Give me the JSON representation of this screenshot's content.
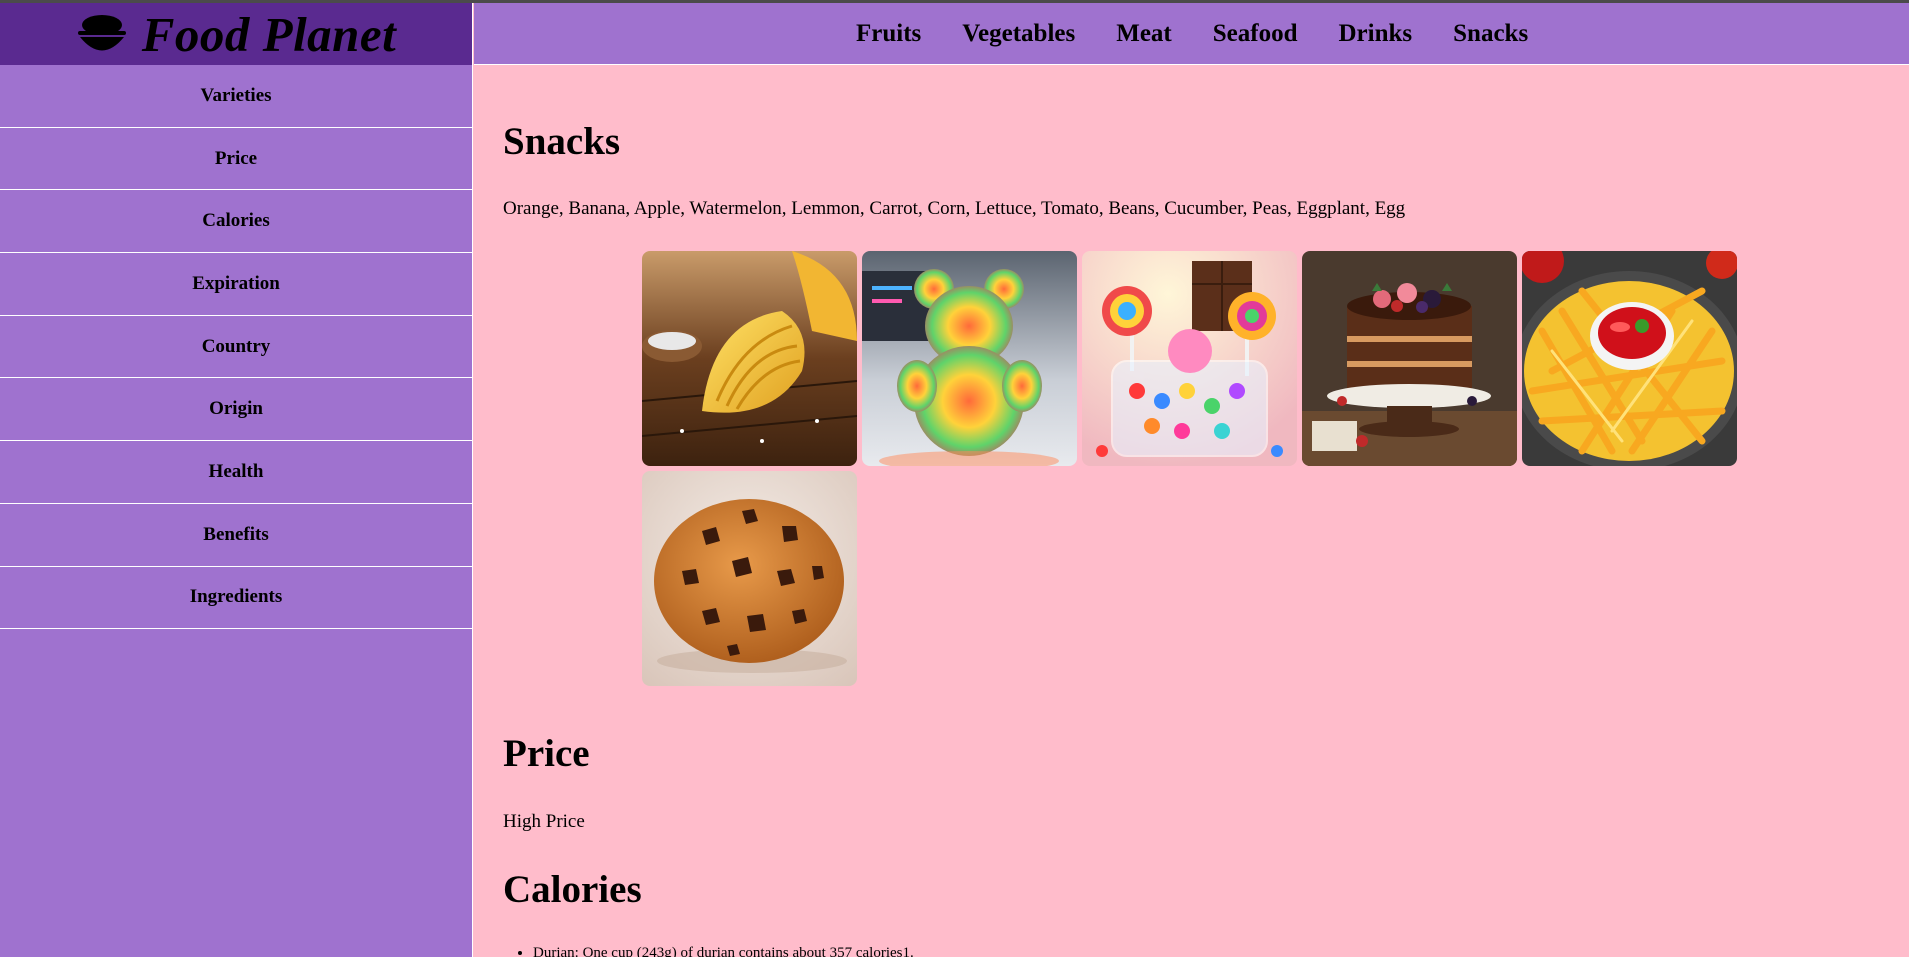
{
  "brand": {
    "title": "Food Planet",
    "icon": "food-bowl-icon"
  },
  "topnav": [
    "Fruits",
    "Vegetables",
    "Meat",
    "Seafood",
    "Drinks",
    "Snacks"
  ],
  "sidebar": [
    "Varieties",
    "Price",
    "Calories",
    "Expiration",
    "Country",
    "Origin",
    "Health",
    "Benefits",
    "Ingredients"
  ],
  "main": {
    "snacks_heading": "Snacks",
    "snacks_text": "Orange, Banana, Apple, Watermelon, Lemmon, Carrot, Corn, Lettuce, Tomato, Beans, Cucumber, Peas, Eggplant, Egg",
    "images": [
      "potato-chips",
      "gummy-bear",
      "candy-jar",
      "chocolate-cake",
      "french-fries",
      "chocolate-chip-cookie"
    ],
    "price_heading": "Price",
    "price_text": "High Price",
    "calories_heading": "Calories",
    "calories_items": [
      "Durian: One cup (243g) of durian contains about 357 calories1."
    ]
  },
  "colors": {
    "nav_bg": "#9f72cf",
    "brand_bg": "#5a2a90",
    "page_bg": "#ffbccb"
  }
}
